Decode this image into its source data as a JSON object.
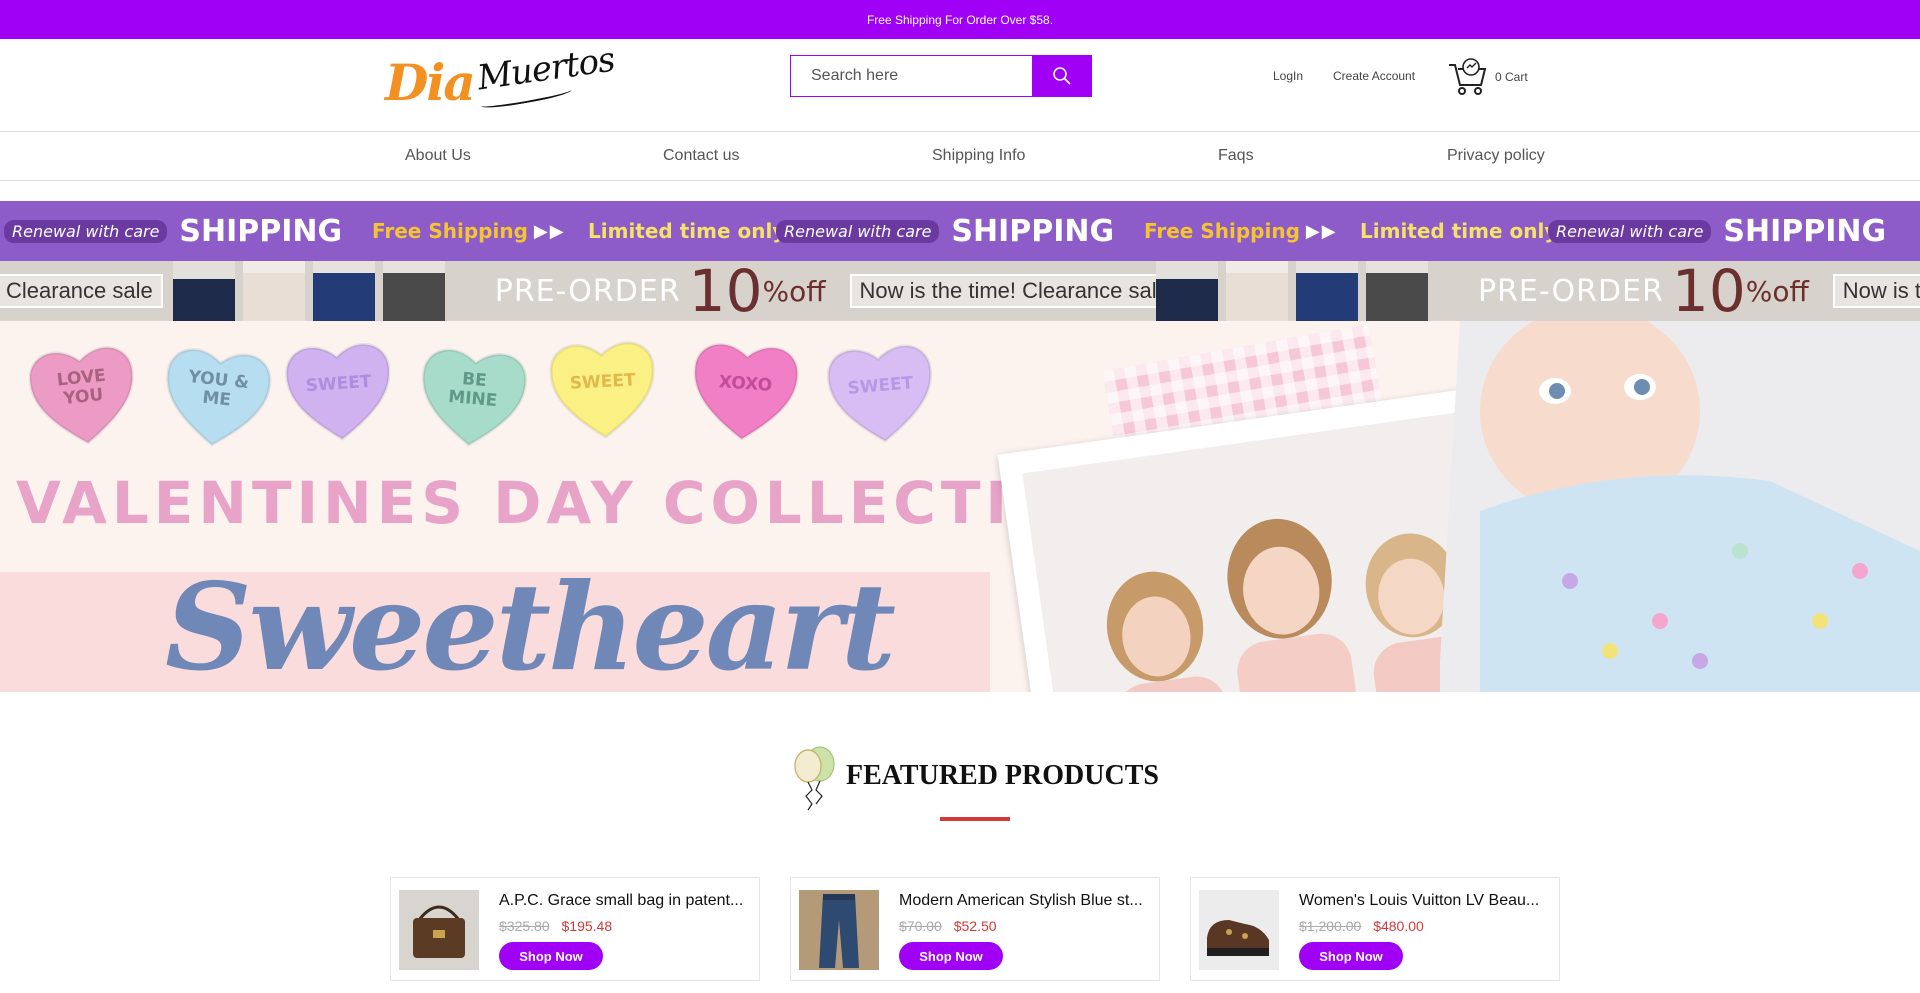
{
  "announcement": "Free Shipping For Order Over $58.",
  "header": {
    "logo_text_1": "Dia",
    "logo_text_2": "Muertos",
    "search_placeholder": "Search here",
    "login_label": "LogIn",
    "create_account_label": "Create Account",
    "cart_label": "0 Cart"
  },
  "nav": {
    "items": [
      "About Us",
      "Contact us",
      "Shipping Info",
      "Faqs",
      "Privacy policy"
    ]
  },
  "banner1": {
    "renewal": "Renewal with care",
    "shipping": "SHIPPING",
    "free_shipping": "Free Shipping",
    "limited": "Limited time only"
  },
  "banner2": {
    "clearance_partial": "Clearance sale",
    "preorder": "PRE-ORDER",
    "percent": "10",
    "off": "%off",
    "now_text": "Now is the time! Clearance sale",
    "now_partial": "Now is the t"
  },
  "hero": {
    "hearts": [
      {
        "label": "LOVE\nYOU",
        "color": "#ec9cc4",
        "text_color": "#a8627f"
      },
      {
        "label": "YOU &\nME",
        "color": "#b6def0",
        "text_color": "#6f8fa3"
      },
      {
        "label": "SWEET",
        "color": "#cfb2ef",
        "text_color": "#ad8ddf"
      },
      {
        "label": "BE\nMINE",
        "color": "#a7dccb",
        "text_color": "#5f9a88"
      },
      {
        "label": "SWEET",
        "color": "#faf084",
        "text_color": "#e0b84c"
      },
      {
        "label": "XOXO",
        "color": "#f07fc6",
        "text_color": "#c24c97"
      },
      {
        "label": "SWEET",
        "color": "#d7bdf3",
        "text_color": "#b797e6"
      }
    ],
    "collection_title": "VALENTINES DAY COLLECTION",
    "sweetheart": "Sweetheart"
  },
  "featured_title": "FEATURED PRODUCTS",
  "products": [
    {
      "name": "A.P.C. Grace small bag in patent...",
      "old_price": "$325.80",
      "new_price": "$195.48",
      "button": "Shop Now",
      "image": "brown-bag"
    },
    {
      "name": "Modern American Stylish Blue st...",
      "old_price": "$70.00",
      "new_price": "$52.50",
      "button": "Shop Now",
      "image": "blue-jeans"
    },
    {
      "name": "Women's Louis Vuitton LV Beau...",
      "old_price": "$1,200.00",
      "new_price": "$480.00",
      "button": "Shop Now",
      "image": "brown-shoes"
    }
  ],
  "colors": {
    "accent": "#a000f5",
    "sale": "#d33939",
    "banner_purple": "#8e5cc8"
  }
}
